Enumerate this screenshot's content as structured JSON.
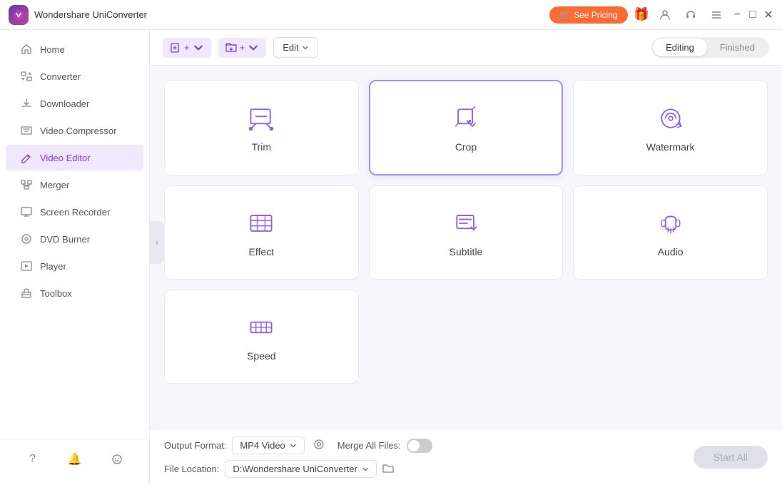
{
  "app": {
    "title": "Wondershare UniConverter",
    "logo_alt": "app-logo"
  },
  "titlebar": {
    "see_pricing": "See Pricing",
    "minimize": "−",
    "maximize": "□",
    "close": "✕"
  },
  "sidebar": {
    "items": [
      {
        "id": "home",
        "label": "Home",
        "icon": "home-icon"
      },
      {
        "id": "converter",
        "label": "Converter",
        "icon": "converter-icon"
      },
      {
        "id": "downloader",
        "label": "Downloader",
        "icon": "downloader-icon"
      },
      {
        "id": "video-compressor",
        "label": "Video Compressor",
        "icon": "compress-icon"
      },
      {
        "id": "video-editor",
        "label": "Video Editor",
        "icon": "edit-icon",
        "active": true
      },
      {
        "id": "merger",
        "label": "Merger",
        "icon": "merger-icon"
      },
      {
        "id": "screen-recorder",
        "label": "Screen Recorder",
        "icon": "screen-icon"
      },
      {
        "id": "dvd-burner",
        "label": "DVD Burner",
        "icon": "dvd-icon"
      },
      {
        "id": "player",
        "label": "Player",
        "icon": "player-icon"
      },
      {
        "id": "toolbox",
        "label": "Toolbox",
        "icon": "toolbox-icon"
      }
    ],
    "bottom_icons": [
      "help-icon",
      "bell-icon",
      "feedback-icon"
    ]
  },
  "toolbar": {
    "add_file_label": "+",
    "add_folder_label": "+",
    "edit_label": "Edit",
    "tabs": [
      {
        "id": "editing",
        "label": "Editing",
        "active": true
      },
      {
        "id": "finished",
        "label": "Finished",
        "active": false
      }
    ]
  },
  "grid": {
    "cards": [
      {
        "id": "trim",
        "label": "Trim",
        "icon": "trim-icon",
        "highlighted": false
      },
      {
        "id": "crop",
        "label": "Crop",
        "icon": "crop-icon",
        "highlighted": true
      },
      {
        "id": "watermark",
        "label": "Watermark",
        "icon": "watermark-icon",
        "highlighted": false
      },
      {
        "id": "effect",
        "label": "Effect",
        "icon": "effect-icon",
        "highlighted": false
      },
      {
        "id": "subtitle",
        "label": "Subtitle",
        "icon": "subtitle-icon",
        "highlighted": false
      },
      {
        "id": "audio",
        "label": "Audio",
        "icon": "audio-icon",
        "highlighted": false
      },
      {
        "id": "speed",
        "label": "Speed",
        "icon": "speed-icon",
        "highlighted": false
      }
    ]
  },
  "bottombar": {
    "output_format_label": "Output Format:",
    "output_format_value": "MP4 Video",
    "file_location_label": "File Location:",
    "file_location_value": "D:\\Wondershare UniConverter",
    "merge_label": "Merge All Files:",
    "start_all_label": "Start All"
  }
}
